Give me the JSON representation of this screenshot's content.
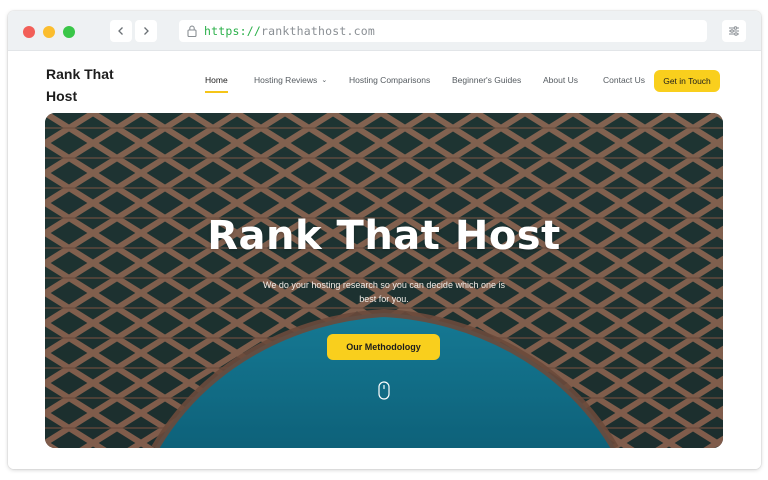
{
  "browser": {
    "url_protocol": "https://",
    "url_host": "rankthathost.com"
  },
  "site": {
    "logo": "Rank That Host",
    "nav": [
      {
        "label": "Home",
        "active": true
      },
      {
        "label": "Hosting Reviews",
        "dropdown": true
      },
      {
        "label": "Hosting Comparisons"
      },
      {
        "label": "Beginner's Guides"
      },
      {
        "label": "About Us"
      },
      {
        "label": "Contact Us"
      }
    ],
    "cta_label": "Get in Touch"
  },
  "hero": {
    "title": "Rank That Host",
    "subtitle": "We do your hosting research so you can decide which one is best for you.",
    "button_label": "Our Methodology"
  },
  "colors": {
    "accent": "#f9cf1d",
    "url_protocol": "#2bb04a",
    "sky": "#1a8fb0",
    "brick": "#b9856b"
  },
  "icons": [
    "back-arrow-icon",
    "forward-arrow-icon",
    "lock-icon",
    "sliders-icon",
    "chevron-down-icon",
    "mouse-scroll-icon"
  ]
}
